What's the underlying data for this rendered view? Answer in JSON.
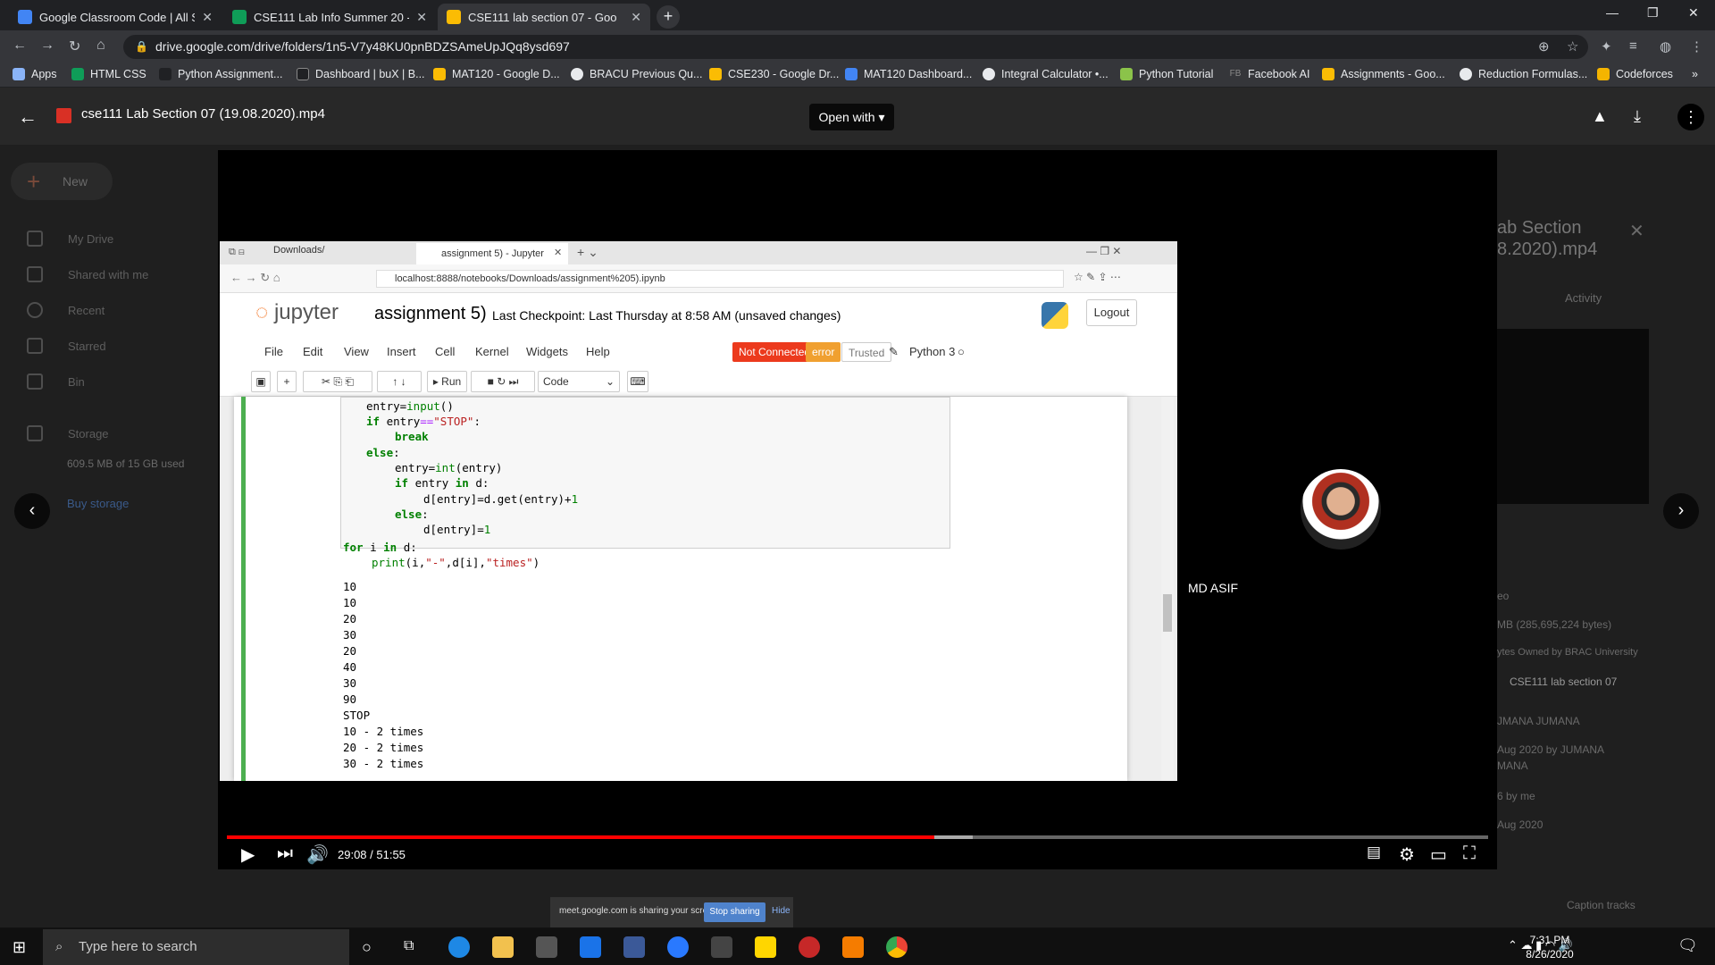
{
  "browser": {
    "tabs": [
      {
        "title": "Google Classroom Code | All Sec",
        "color": "#4285f4"
      },
      {
        "title": "CSE111 Lab Info Summer 20 - Gc",
        "color": "#0f9d58"
      },
      {
        "title": "CSE111 lab section 07 - Goo",
        "color": "#fbbc04"
      }
    ],
    "new_tab_label": "+",
    "url": "drive.google.com/drive/folders/1n5-V7y48KU0pnBDZSAmeUpJQq8ysd697",
    "bookmarks": [
      {
        "label": "Apps",
        "color": "#8ab4f8"
      },
      {
        "label": "HTML CSS",
        "color": "#0f9d58"
      },
      {
        "label": "Python Assignment...",
        "color": "#35363a"
      },
      {
        "label": "Dashboard | buX | B...",
        "color": "#35363a"
      },
      {
        "label": "MAT120 - Google D...",
        "color": "#fbbc04"
      },
      {
        "label": "BRACU Previous Qu...",
        "color": "#e8eaed"
      },
      {
        "label": "CSE230 - Google Dr...",
        "color": "#fbbc04"
      },
      {
        "label": "MAT120 Dashboard...",
        "color": "#4285f4"
      },
      {
        "label": "Integral Calculator •...",
        "color": "#e8eaed"
      },
      {
        "label": "Python Tutorial",
        "color": "#8bc34a"
      },
      {
        "label": "Facebook AI",
        "color": "#35363a"
      },
      {
        "label": "Assignments - Goo...",
        "color": "#fbbc04"
      },
      {
        "label": "Reduction Formulas...",
        "color": "#e8eaed"
      },
      {
        "label": "Codeforces",
        "color": "#f4b400"
      }
    ]
  },
  "drive": {
    "file_name": "cse111 Lab Section 07 (19.08.2020).mp4",
    "open_with_label": "Open with",
    "new_label": "New",
    "sidebar": [
      "My Drive",
      "Shared with me",
      "Recent",
      "Starred",
      "Bin"
    ],
    "storage_label": "Storage",
    "storage_used": "609.5 MB of 15 GB used",
    "buy_storage": "Buy storage",
    "details": {
      "title": "ab Section",
      "title2": "8.2020).mp4",
      "activity_tab": "Activity",
      "type": "eo",
      "size": "MB (285,695,224 bytes)",
      "owner": "ytes  Owned by BRAC University",
      "location": "CSE111 lab section 07",
      "owner_name": "JMANA JUMANA",
      "modified": "Aug 2020 by JUMANA",
      "modified2": "MANA",
      "opened": "6 by me",
      "created": "Aug 2020",
      "caption_tracks": "Caption tracks"
    }
  },
  "jupyter": {
    "tab1": "Downloads/",
    "tab2": "assignment 5) - Jupyter",
    "url": "localhost:8888/notebooks/Downloads/assignment%205).ipynb",
    "logo_text": "jupyter",
    "notebook_title": "assignment 5)",
    "checkpoint": "Last Checkpoint: Last Thursday at 8:58 AM  (unsaved changes)",
    "logout": "Logout",
    "menu": [
      "File",
      "Edit",
      "View",
      "Insert",
      "Cell",
      "Kernel",
      "Widgets",
      "Help"
    ],
    "not_connected": "Not Connected",
    "error": "error",
    "trusted": "Trusted",
    "kernel": "Python 3",
    "run_label": "Run",
    "cell_type": "Code",
    "output": [
      "10",
      "10",
      "20",
      "30",
      "20",
      "40",
      "30",
      "90",
      "STOP",
      "10 - 2 times",
      "20 - 2 times",
      "30 - 2 times"
    ],
    "share_msg": "meet.google.com is sharing your screen.",
    "stop_sharing": "Stop sharing",
    "hide": "Hide"
  },
  "meet": {
    "participant": "MD ASIF"
  },
  "player": {
    "time": "29:08 / 51:55",
    "progress": 0.561
  },
  "taskbar": {
    "search_placeholder": "Type here to search",
    "time": "7:31 PM",
    "date": "8/26/2020"
  }
}
